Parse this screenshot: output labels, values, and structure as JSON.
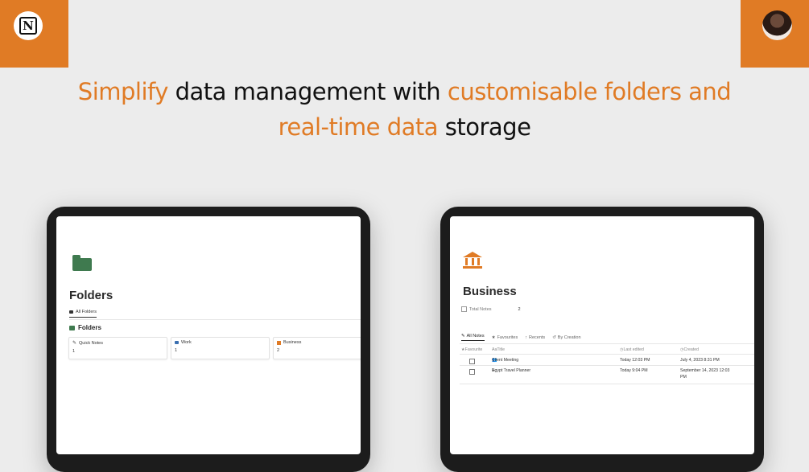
{
  "headline": {
    "part1": "Simplify",
    "part2": " data management with ",
    "part3": "customisable folders and",
    "part4": "real-time data",
    "part5": " storage"
  },
  "colors": {
    "accent": "#e07b25",
    "folder_green": "#3f7a4f"
  },
  "folders_screen": {
    "title": "Folders",
    "tab_label": "All Folders",
    "section_title": "Folders",
    "cards": [
      {
        "label": "Quick Notes",
        "count": "1",
        "icon": "pencil-icon"
      },
      {
        "label": "Work",
        "count": "1",
        "icon": "briefcase-icon"
      },
      {
        "label": "Business",
        "count": "2",
        "icon": "bank-icon"
      }
    ]
  },
  "business_screen": {
    "title": "Business",
    "property_label": "Total Notes",
    "property_value": "2",
    "views": [
      "All Notes",
      "Favourites",
      "Recents",
      "By Creation"
    ],
    "columns": [
      "Favourite",
      "Title",
      "Last edited",
      "Created"
    ],
    "rows": [
      {
        "title": "Client Meeting",
        "last_edited": "Today 12:03 PM",
        "created": "July 4, 2023 8:31 PM"
      },
      {
        "title": "Egypt Travel Planner",
        "last_edited": "Today 9:04 PM",
        "created": "September 14, 2023 12:03",
        "created_2": "PM"
      }
    ]
  }
}
